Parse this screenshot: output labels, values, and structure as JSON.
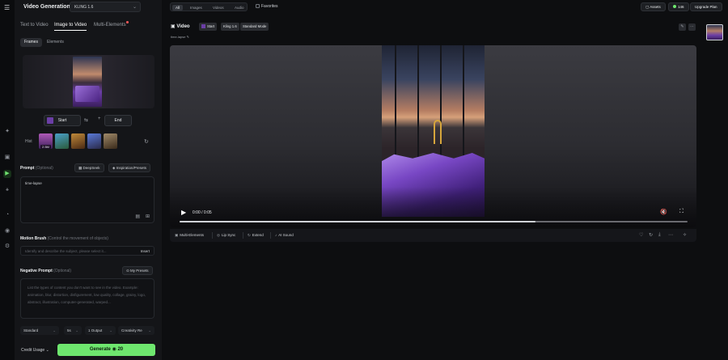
{
  "app": {
    "title": "Video Generation",
    "model": "KLING 1.6"
  },
  "modes": [
    {
      "label": "Text to Video",
      "active": false
    },
    {
      "label": "Image to Video",
      "active": true
    },
    {
      "label": "Multi-Elements",
      "active": false
    }
  ],
  "subtabs": [
    {
      "label": "Frames",
      "active": true
    },
    {
      "label": "Elements",
      "active": false
    }
  ],
  "frames": {
    "start_label": "Start",
    "end_label": "End"
  },
  "history": {
    "label": "Hist",
    "badge": "2.5M"
  },
  "prompt": {
    "label": "Prompt",
    "optional": "(Optional)",
    "deepseek": "DeepSeek",
    "inspiration": "Inspiration/Presets",
    "value": "time-lapse"
  },
  "motion": {
    "label": "Motion Brush",
    "note": "(Control the movement of objects)",
    "placeholder": "Identify and describe the subject, please select it...",
    "action": "Insert"
  },
  "negative": {
    "label": "Negative Prompt",
    "optional": "(Optional)",
    "presets": "My Presets",
    "placeholder": "List the types of content you don't want to see in the video. Example: animation, blur, distortion, disfigurement, low quality, collage, grainy, logo, abstract, illustration, computer-generated, warped..."
  },
  "options": {
    "mode": "Standard",
    "duration": "5s",
    "outputs": "1 Output",
    "creativity": "Creativity Re"
  },
  "footer": {
    "credit_usage": "Credit Usage",
    "generate": "Generate",
    "cost": "20"
  },
  "topbar": {
    "filters": [
      {
        "label": "All",
        "active": true
      },
      {
        "label": "Images",
        "active": false
      },
      {
        "label": "Videos",
        "active": false
      },
      {
        "label": "Audio",
        "active": false
      }
    ],
    "favorites": "Favorites",
    "assets": "Assets",
    "credits": "146",
    "upgrade": "Upgrade Plan"
  },
  "video": {
    "title": "Video",
    "tags": [
      "Start",
      "Kling 1.6",
      "Standard Mode"
    ],
    "caption": "time-lapse",
    "time": "0:00 / 0:05",
    "progress": 0.7
  },
  "tools": {
    "multi": "Multi-Elements",
    "lipsync": "Lip Sync",
    "extend": "Extend",
    "sound": "AI Sound"
  },
  "colors": {
    "accent": "#6ee76e",
    "purple": "#6b3ea6",
    "panel": "#141518"
  }
}
